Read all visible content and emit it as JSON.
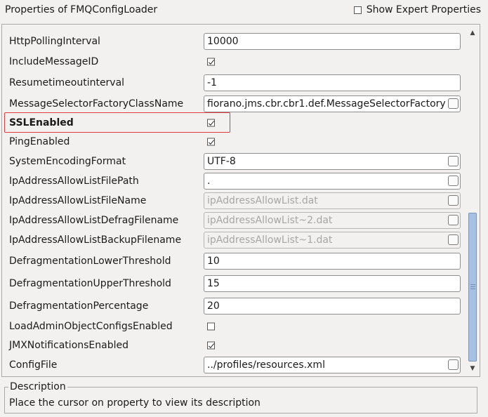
{
  "window": {
    "title": "Properties of FMQConfigLoader",
    "show_expert_label": "Show Expert Properties",
    "show_expert_checked": false
  },
  "properties": [
    {
      "name": "HttpPollingInterval",
      "type": "text",
      "value": "10000",
      "button": false,
      "disabled": false,
      "bold": false
    },
    {
      "name": "IncludeMessageID",
      "type": "checkbox",
      "checked": true,
      "bold": false
    },
    {
      "name": "Resumetimeoutinterval",
      "type": "text",
      "value": "-1",
      "button": false,
      "disabled": false,
      "bold": false
    },
    {
      "name": "MessageSelectorFactoryClassName",
      "type": "text",
      "value": "fiorano.jms.cbr.cbr1.def.MessageSelectorFactory",
      "button": true,
      "disabled": false,
      "bold": false
    },
    {
      "name": "SSLEnabled",
      "type": "checkbox",
      "checked": true,
      "bold": true,
      "highlighted": true
    },
    {
      "name": "PingEnabled",
      "type": "checkbox",
      "checked": true,
      "bold": false
    },
    {
      "name": "SystemEncodingFormat",
      "type": "text",
      "value": "UTF-8",
      "button": true,
      "disabled": false,
      "bold": false
    },
    {
      "name": "IpAddressAllowListFilePath",
      "type": "text",
      "value": ".",
      "button": true,
      "disabled": false,
      "bold": false
    },
    {
      "name": "IpAddressAllowListFileName",
      "type": "text",
      "value": "ipAddressAllowList.dat",
      "button": true,
      "disabled": true,
      "bold": false
    },
    {
      "name": "IpAddressAllowListDefragFilename",
      "type": "text",
      "value": "ipAddressAllowList~2.dat",
      "button": true,
      "disabled": true,
      "bold": false
    },
    {
      "name": "IpAddressAllowListBackupFilename",
      "type": "text",
      "value": "ipAddressAllowList~1.dat",
      "button": true,
      "disabled": true,
      "bold": false
    },
    {
      "name": "DefragmentationLowerThreshold",
      "type": "text",
      "value": "10",
      "button": false,
      "disabled": false,
      "bold": false
    },
    {
      "name": "DefragmentationUpperThreshold",
      "type": "text",
      "value": "15",
      "button": false,
      "disabled": false,
      "bold": false
    },
    {
      "name": "DefragmentationPercentage",
      "type": "text",
      "value": "20",
      "button": false,
      "disabled": false,
      "bold": false
    },
    {
      "name": "LoadAdminObjectConfigsEnabled",
      "type": "checkbox",
      "checked": false,
      "bold": false
    },
    {
      "name": "JMXNotificationsEnabled",
      "type": "checkbox",
      "checked": true,
      "bold": false
    },
    {
      "name": "ConfigFile",
      "type": "text",
      "value": "../profiles/resources.xml",
      "button": true,
      "disabled": false,
      "bold": false
    }
  ],
  "scrollbar": {
    "position_fraction": 0.54,
    "visible_fraction": 0.46
  },
  "description": {
    "title": "Description",
    "text": "Place the cursor on property to view its description"
  },
  "colors": {
    "highlight": "#e03a3a",
    "scroll_thumb": "#a7c1e5"
  }
}
